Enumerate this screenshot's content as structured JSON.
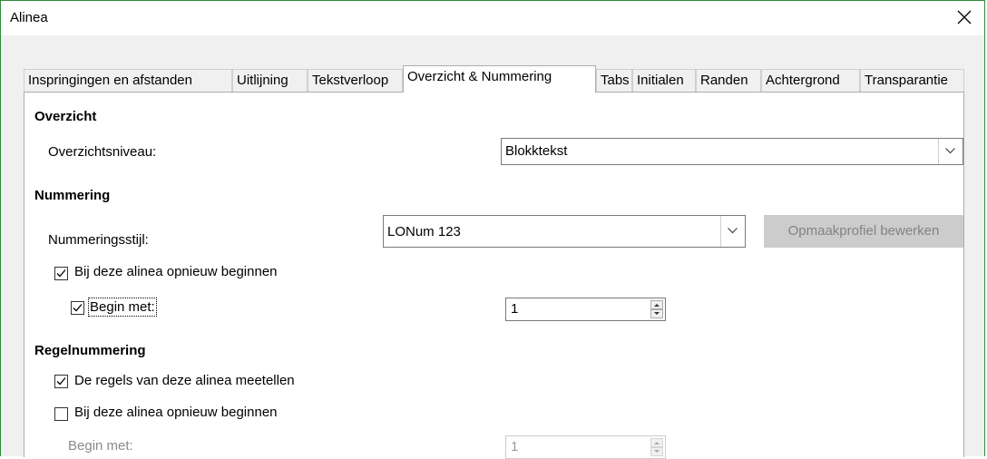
{
  "window": {
    "title": "Alinea",
    "close_icon": "close-icon"
  },
  "tabs": [
    {
      "label": "Inspringingen en afstanden"
    },
    {
      "label": "Uitlijning"
    },
    {
      "label": "Tekstverloop"
    },
    {
      "label": "Overzicht & Nummering"
    },
    {
      "label": "Tabs"
    },
    {
      "label": "Initialen"
    },
    {
      "label": "Randen"
    },
    {
      "label": "Achtergrond"
    },
    {
      "label": "Transparantie"
    }
  ],
  "active_tab": "Overzicht & Nummering",
  "overzicht": {
    "heading": "Overzicht",
    "level_label": "Overzichtsniveau:",
    "level_value": "Blokktekst"
  },
  "nummering": {
    "heading": "Nummering",
    "style_label": "Nummeringsstijl:",
    "style_value": "LONum 123",
    "edit_button": "Opmaakprofiel bewerken",
    "restart_label": "Bij deze alinea opnieuw beginnen",
    "restart_checked": true,
    "start_label": "Begin met:",
    "start_checked": true,
    "start_value": "1"
  },
  "regelnummering": {
    "heading": "Regelnummering",
    "count_label": "De regels van deze alinea meetellen",
    "count_checked": true,
    "restart_label": "Bij deze alinea opnieuw beginnen",
    "restart_checked": false,
    "start_label": "Begin met:",
    "start_value": "1"
  }
}
